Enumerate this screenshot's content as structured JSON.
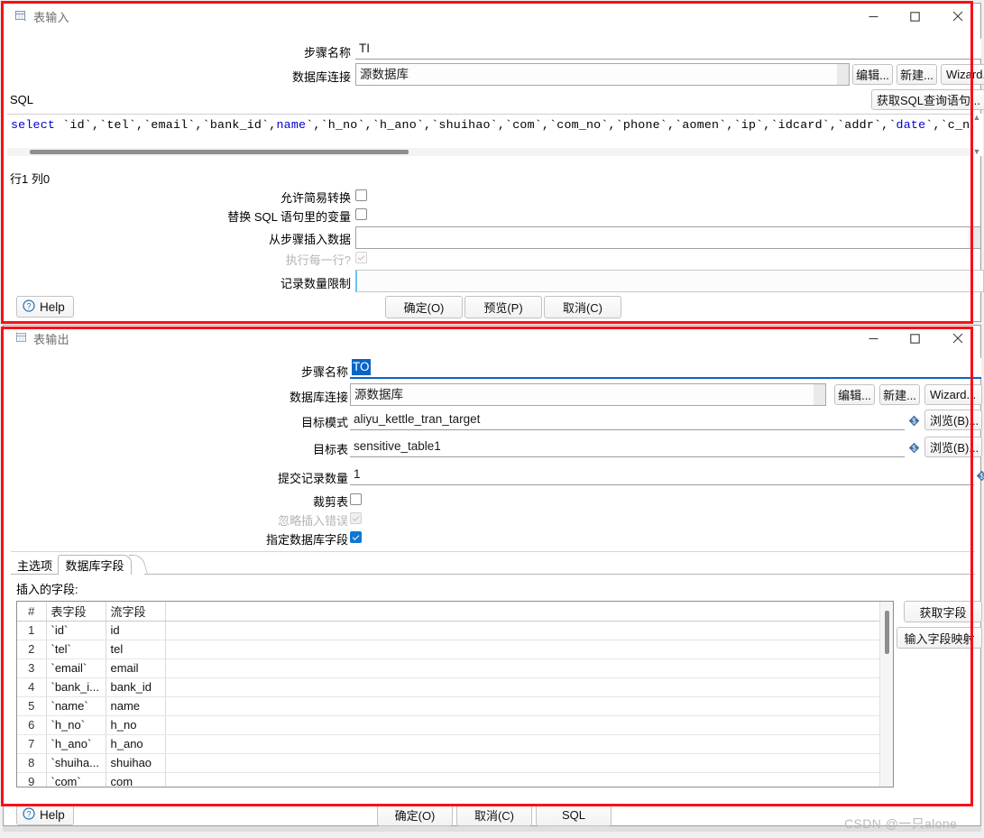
{
  "annotation": {
    "color": "#fa0f16",
    "watermark": "CSDN @一只alone"
  },
  "table_input_dialog": {
    "title": "表输入",
    "icon": "table-input-icon",
    "window_controls": {
      "minimize": "minimize-icon",
      "maximize": "maximize-icon",
      "close": "close-icon"
    },
    "fields": {
      "step_name_label": "步骤名称",
      "step_name_value": "TI",
      "connection_label": "数据库连接",
      "connection_value": "源数据库"
    },
    "connection_buttons": [
      {
        "name": "edit-connection-button",
        "label": "编辑..."
      },
      {
        "name": "new-connection-button",
        "label": "新建..."
      },
      {
        "name": "wizard-connection-button",
        "label": "Wizard..."
      }
    ],
    "sql_section_label": "SQL",
    "get_sql_button": "获取SQL查询语句...",
    "sql_text": "select `id`,`tel`,`email`,`bank_id`,`name`,`h_no`,`h_ano`,`shuihao`,`com`,`com_no`,`phone`,`aomen`,`ip`,`idcard`,`addr`,`date`,`c_no`",
    "sql_tokens": [
      {
        "text": "select",
        "keyword": true
      },
      {
        "text": " `id`,`tel`,`email`,`bank_id`,",
        "keyword": false
      },
      {
        "text": "name",
        "keyword": true
      },
      {
        "text": "`,`h_no`,`h_ano`,`shuihao`,`com`,`com_no`,`phone`,`aomen`,`ip`,`idcard`,`addr`,`",
        "keyword": false
      },
      {
        "text": "date",
        "keyword": true
      },
      {
        "text": "`,`c_no`",
        "keyword": false
      }
    ],
    "caret_status": "行1 列0",
    "options": [
      {
        "name": "allow-lazy-conversion",
        "label": "允许简易转换",
        "type": "checkbox",
        "checked": false,
        "disabled": false
      },
      {
        "name": "replace-variables-in-sql",
        "label": "替换 SQL 语句里的变量",
        "type": "checkbox",
        "checked": false,
        "disabled": false
      },
      {
        "name": "insert-data-from-step",
        "label": "从步骤插入数据",
        "type": "text",
        "value": ""
      },
      {
        "name": "execute-for-each-row",
        "label": "执行每一行?",
        "type": "checkbox",
        "checked": false,
        "disabled": true
      },
      {
        "name": "record-limit",
        "label": "记录数量限制",
        "type": "text",
        "value": ""
      }
    ],
    "footer": {
      "help_label": "Help",
      "ok_label": "确定(O)",
      "preview_label": "预览(P)",
      "cancel_label": "取消(C)"
    }
  },
  "table_output_dialog": {
    "title": "表输出",
    "icon": "table-output-icon",
    "window_controls": {
      "minimize": "minimize-icon",
      "maximize": "maximize-icon",
      "close": "close-icon"
    },
    "fields": {
      "step_name_label": "步骤名称",
      "step_name_value": "TO",
      "step_name_selected": true,
      "connection_label": "数据库连接",
      "connection_value": "源数据库",
      "target_schema_label": "目标模式",
      "target_schema_value": "aliyu_kettle_tran_target",
      "target_table_label": "目标表",
      "target_table_value": "sensitive_table1",
      "commit_size_label": "提交记录数量",
      "commit_size_value": "1"
    },
    "connection_buttons": [
      {
        "name": "edit-connection-button",
        "label": "编辑..."
      },
      {
        "name": "new-connection-button",
        "label": "新建..."
      },
      {
        "name": "wizard-connection-button",
        "label": "Wizard..."
      }
    ],
    "browse_buttons": [
      {
        "name": "browse-schema-button",
        "label": "浏览(B)..."
      },
      {
        "name": "browse-table-button",
        "label": "浏览(B)..."
      }
    ],
    "checkboxes": [
      {
        "name": "truncate-table-checkbox",
        "label": "裁剪表",
        "checked": false,
        "disabled": false
      },
      {
        "name": "ignore-insert-errors-checkbox",
        "label": "忽略插入错误",
        "checked": true,
        "disabled": true
      },
      {
        "name": "specify-database-fields-checkbox",
        "label": "指定数据库字段",
        "checked": true,
        "disabled": false
      }
    ],
    "tabs": [
      {
        "name": "tab-main-options",
        "label": "主选项",
        "active": false
      },
      {
        "name": "tab-database-fields",
        "label": "数据库字段",
        "active": true
      }
    ],
    "fields_section_label": "插入的字段:",
    "grid": {
      "columns": [
        "#",
        "表字段",
        "流字段",
        ""
      ],
      "rows": [
        [
          "1",
          "`id`",
          "id",
          ""
        ],
        [
          "2",
          "`tel`",
          "tel",
          ""
        ],
        [
          "3",
          "`email`",
          "email",
          ""
        ],
        [
          "4",
          "`bank_i...",
          "bank_id",
          ""
        ],
        [
          "5",
          "`name`",
          "name",
          ""
        ],
        [
          "6",
          "`h_no`",
          "h_no",
          ""
        ],
        [
          "7",
          "`h_ano`",
          "h_ano",
          ""
        ],
        [
          "8",
          "`shuiha...",
          "shuihao",
          ""
        ],
        [
          "9",
          "`com`",
          "com",
          ""
        ]
      ]
    },
    "grid_buttons": [
      {
        "name": "get-fields-button",
        "label": "获取字段"
      },
      {
        "name": "input-field-mapping-button",
        "label": "输入字段映射"
      }
    ],
    "footer": {
      "help_label": "Help",
      "ok_label": "确定(O)",
      "cancel_label": "取消(C)",
      "sql_label": "SQL"
    }
  }
}
